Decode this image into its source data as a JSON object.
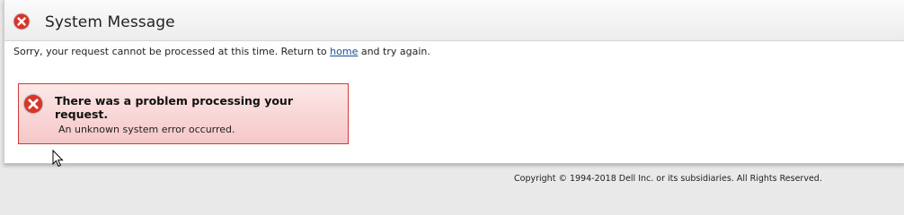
{
  "header": {
    "title": "System Message",
    "icon": "error-icon"
  },
  "message": {
    "before_link": "Sorry, your request cannot be processed at this time. Return to ",
    "link_text": "home",
    "after_link": " and try again."
  },
  "error_box": {
    "title": "There was a problem processing your request.",
    "detail": "An unknown system error occurred.",
    "icon": "error-icon"
  },
  "footer": {
    "copyright": "Copyright © 1994-2018 Dell Inc. or its subsidiaries. All Rights Reserved."
  },
  "colors": {
    "error_red": "#d9342b",
    "error_box_border": "#d23a3a",
    "error_box_bg": "#f9d6d6",
    "link": "#1a4d99"
  }
}
